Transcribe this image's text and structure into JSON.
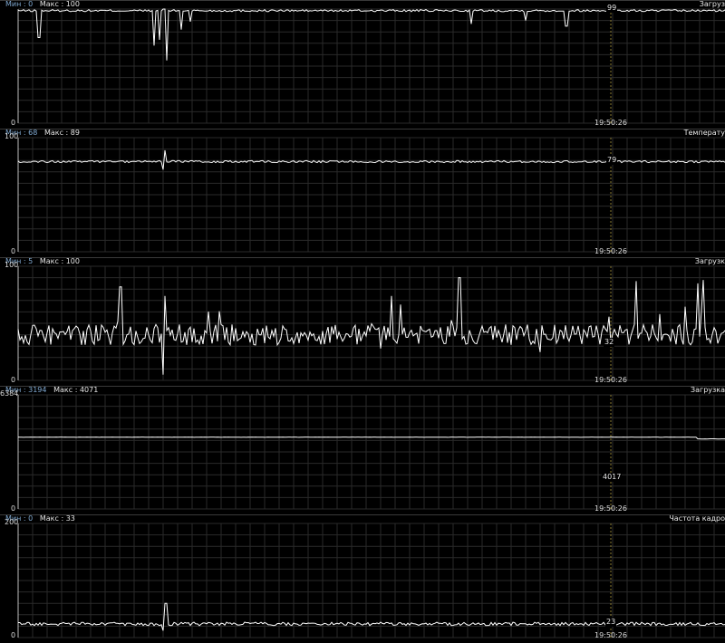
{
  "labels": {
    "min": "Мин :",
    "max": "Макс :"
  },
  "panels": [
    {
      "id": "p1",
      "min_value": "0",
      "max_value": "100",
      "title": "Загруз",
      "y_top": "100",
      "y_bottom": "0",
      "time": "19:50:26",
      "current": "99",
      "range": [
        0,
        100
      ],
      "base": 98.6,
      "noise": 0.9,
      "spike_prob": 0.0,
      "dips": [
        [
          43,
          75
        ],
        [
          170,
          68
        ],
        [
          176,
          73
        ],
        [
          181,
          100
        ],
        [
          184,
          55
        ],
        [
          200,
          82
        ],
        [
          210,
          89
        ],
        [
          520,
          87
        ],
        [
          580,
          90
        ],
        [
          625,
          85
        ]
      ],
      "current_pos": "top"
    },
    {
      "id": "p2",
      "min_value": "68",
      "max_value": "89",
      "title": "Температу",
      "y_top": "100",
      "y_bottom": "0",
      "time": "19:50:26",
      "current": "79",
      "range": [
        0,
        100
      ],
      "base": 79,
      "noise": 0.9,
      "spike_prob": 0.0,
      "dips": [
        [
          180,
          72
        ],
        [
          182,
          89
        ]
      ],
      "current_pos": "line"
    },
    {
      "id": "p3",
      "min_value": "5",
      "max_value": "100",
      "title": "Загрузк",
      "y_top": "100",
      "y_bottom": "0",
      "time": "19:50:26",
      "current": "32",
      "range": [
        0,
        100
      ],
      "base": 40,
      "noise": 9,
      "spike_prob": 0.0,
      "dips": [
        [
          133,
          82
        ],
        [
          180,
          5
        ],
        [
          182,
          74
        ],
        [
          432,
          74
        ],
        [
          507,
          90
        ],
        [
          702,
          87
        ],
        [
          770,
          85
        ],
        [
          776,
          88
        ]
      ],
      "current_pos": "line"
    },
    {
      "id": "p4",
      "min_value": "3194",
      "max_value": "4071",
      "title": "Загрузка",
      "y_top": "6384",
      "y_bottom": "0",
      "time": "19:50:26",
      "current": "4017",
      "range": [
        0,
        6384
      ],
      "base": 4017,
      "noise": 8,
      "spike_prob": 0.0,
      "dips": [],
      "step": [
        770,
        3920
      ],
      "current_pos": "line"
    },
    {
      "id": "p5",
      "min_value": "0",
      "max_value": "33",
      "title": "Частота кадро",
      "y_top": "200",
      "y_bottom": "0",
      "time": "19:50:26",
      "current": "23",
      "range": [
        0,
        200
      ],
      "base": 24,
      "noise": 3,
      "spike_prob": 0.0,
      "dips": [
        [
          180,
          6
        ],
        [
          183,
          30
        ]
      ],
      "current_pos": "line"
    }
  ],
  "colors": {
    "grid": "#2a2a2a",
    "line": "#ffffff",
    "cursor": "#8a7a30",
    "accent": "#7fa8d0"
  }
}
